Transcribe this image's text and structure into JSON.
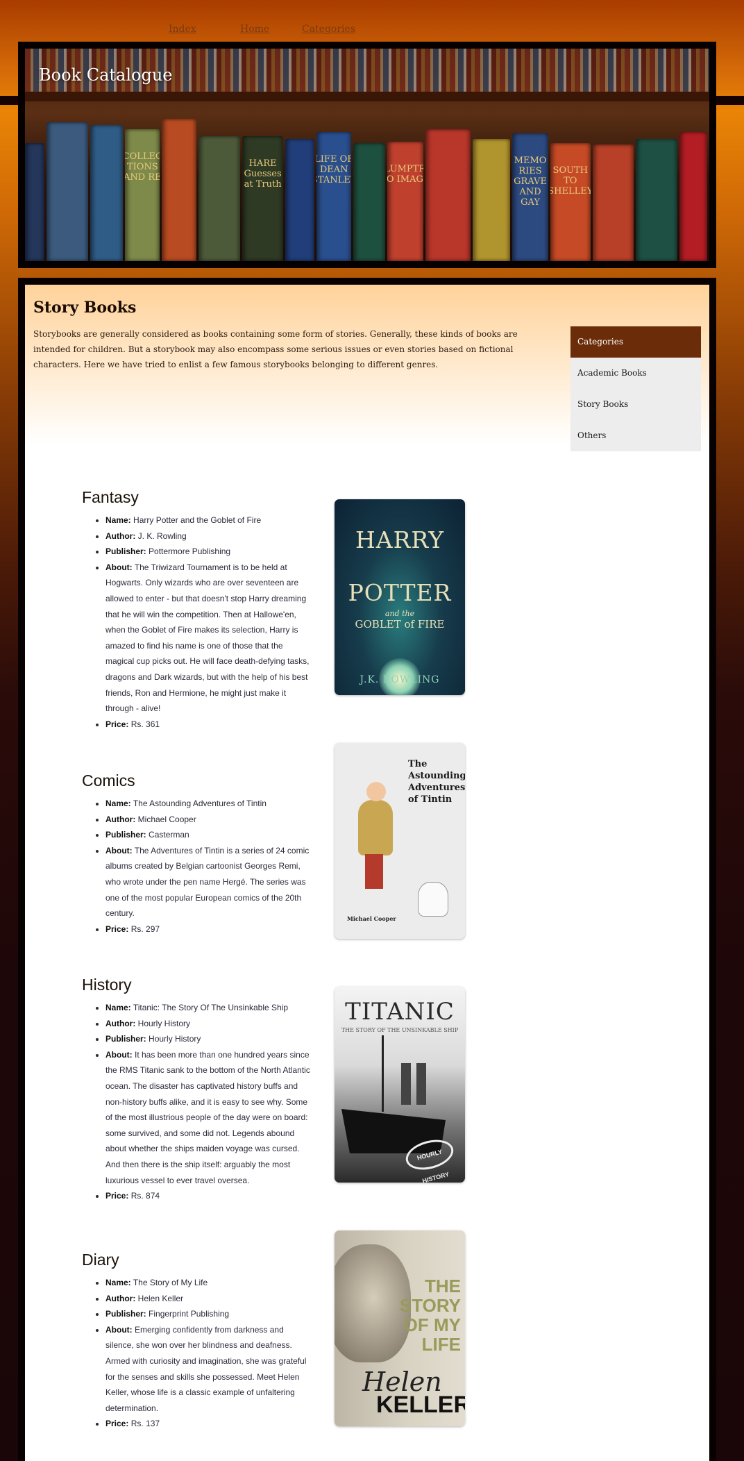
{
  "nav": {
    "links": [
      "Index",
      "Home",
      "Categories"
    ]
  },
  "banner": {
    "title": "Book Catalogue",
    "spines": [
      "HARE Guesses at Truth",
      "LIFE OF DEAN STANLEY",
      "MEMO RIES GRAVE AND GAY",
      "PLUMPTRE TO IMAGE",
      "SOUTH TO SHELLEY",
      "COLLEC TIONS AND RE"
    ]
  },
  "page": {
    "title": "Story Books",
    "intro": "Storybooks are generally considered as books containing some form of stories. Generally, these kinds of books are intended for children. But a storybook may also encompass some serious issues or even stories based on fictional characters. Here we have tried to enlist a few famous storybooks belonging to different genres."
  },
  "sidebar": {
    "header": "Categories",
    "items": [
      "Academic Books",
      "Story Books",
      "Others"
    ]
  },
  "labels": {
    "name": "Name:",
    "author": "Author:",
    "publisher": "Publisher:",
    "about": "About:",
    "price": "Price:"
  },
  "books": [
    {
      "genre": "Fantasy",
      "name": "Harry Potter and the Goblet of Fire",
      "author": "J. K. Rowling",
      "publisher": "Pottermore Publishing",
      "about": "The Triwizard Tournament is to be held at Hogwarts. Only wizards who are over seventeen are allowed to enter - but that doesn't stop Harry dreaming that he will win the competition. Then at Hallowe'en, when the Goblet of Fire makes its selection, Harry is amazed to find his name is one of those that the magical cup picks out. He will face death-defying tasks, dragons and Dark wizards, but with the help of his best friends, Ron and Hermione, he might just make it through - alive!",
      "price": "Rs. 361",
      "cover": {
        "title1": "HARRY",
        "title2": "POTTER",
        "sub1": "and the",
        "sub2": "GOBLET of FIRE",
        "author": "J.K. ROWLING"
      }
    },
    {
      "genre": "Comics",
      "name": "The Astounding Adventures of Tintin",
      "author": "Michael Cooper",
      "publisher": "Casterman",
      "about": "The Adventures of Tintin is a series of 24 comic albums created by Belgian cartoonist Georges Remi, who wrote under the pen name Hergé. The series was one of the most popular European comics of the 20th century.",
      "price": "Rs. 297",
      "cover": {
        "title": "The Astounding Adventures of Tintin",
        "author": "Michael Cooper"
      }
    },
    {
      "genre": "History",
      "name": "Titanic: The Story Of The Unsinkable Ship",
      "author": "Hourly History",
      "publisher": "Hourly History",
      "about": "It has been more than one hundred years since the RMS Titanic sank to the bottom of the North Atlantic ocean. The disaster has captivated history buffs and non-history buffs alike, and it is easy to see why. Some of the most illustrious people of the day were on board: some survived, and some did not. Legends abound about whether the ships maiden voyage was cursed. And then there is the ship itself: arguably the most luxurious vessel to ever travel oversea.",
      "price": "Rs. 874",
      "cover": {
        "title": "TITANIC",
        "subtitle": "THE STORY OF THE UNSINKABLE SHIP",
        "stamp": "HOURLY HISTORY"
      }
    },
    {
      "genre": "Diary",
      "name": "The Story of My Life",
      "author": "Helen Keller",
      "publisher": "Fingerprint Publishing",
      "about": "Emerging confidently from darkness and silence, she won over her blindness and deafness. Armed with curiosity and imagination, she was grateful for the senses and skills she possessed. Meet Helen Keller, whose life is a classic example of unfaltering determination.",
      "price": "Rs. 137",
      "cover": {
        "title1": "THE",
        "title2": "STORY",
        "title3": "OF MY",
        "title4": "LIFE",
        "first": "Helen",
        "last": "KELLER"
      }
    }
  ]
}
